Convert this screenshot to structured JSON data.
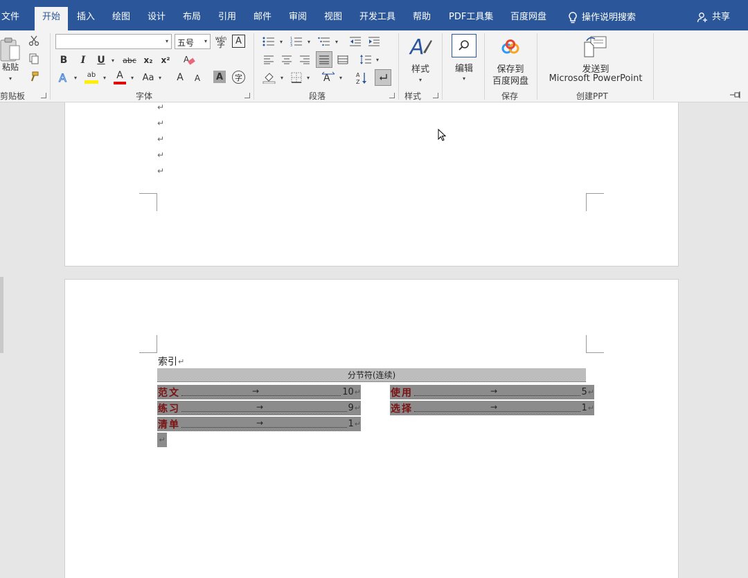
{
  "tabs": {
    "file": "文件",
    "home": "开始",
    "insert": "插入",
    "draw": "绘图",
    "design": "设计",
    "layout": "布局",
    "references": "引用",
    "mailings": "邮件",
    "review": "审阅",
    "view": "视图",
    "developer": "开发工具",
    "help": "帮助",
    "pdf": "PDF工具集",
    "baidu": "百度网盘",
    "search": "操作说明搜索",
    "share": "共享"
  },
  "ribbon": {
    "clipboard": {
      "paste": "粘贴",
      "label": "剪贴板"
    },
    "font": {
      "name_value": "",
      "size_value": "五号",
      "phonetic": "wén",
      "bold": "B",
      "italic": "I",
      "underline": "U",
      "strike": "abc",
      "subscript": "x₂",
      "superscript": "x²",
      "highlight": "ab",
      "font_color": "A",
      "change_case": "Aa",
      "grow": "A",
      "shrink": "A",
      "shading": "A",
      "enclose": "字",
      "label": "字体"
    },
    "paragraph": {
      "label": "段落"
    },
    "styles": {
      "button": "样式",
      "label": "样式"
    },
    "editing": {
      "button": "编辑"
    },
    "save": {
      "line1": "保存到",
      "line2": "百度网盘",
      "label": "保存"
    },
    "ppt": {
      "line1": "发送到",
      "line2": "Microsoft PowerPoint",
      "label": "创建PPT"
    }
  },
  "document": {
    "heading": "索引",
    "section_break": "分节符(连续)",
    "index_left": [
      {
        "term": "范文",
        "page": "10"
      },
      {
        "term": "练习",
        "page": "9"
      },
      {
        "term": "清单",
        "page": "1"
      }
    ],
    "index_right": [
      {
        "term": "使用",
        "page": "5"
      },
      {
        "term": "选择",
        "page": "1"
      }
    ],
    "para_mark": "↵",
    "tab_mark": "→"
  },
  "colors": {
    "ribbon_blue": "#2b579a",
    "ribbon_bg": "#f3f3f3",
    "field_shading": "#8c8c8c",
    "index_term": "#7a1212"
  }
}
